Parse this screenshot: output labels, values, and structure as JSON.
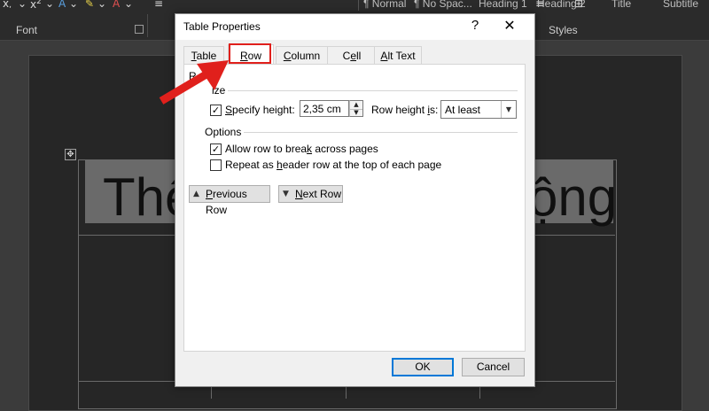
{
  "ribbon": {
    "font_group": "Font",
    "styles_group": "Styles",
    "format_glyphs": [
      "x,",
      "x²"
    ],
    "styles": [
      "¶ Normal",
      "¶ No Spac...",
      "Heading 1",
      "Heading 2",
      "Title",
      "Subtitle"
    ]
  },
  "document": {
    "text_left": "Thê",
    "text_right": "ộng"
  },
  "dialog": {
    "title": "Table Properties",
    "help": "?",
    "close": "✕",
    "tabs": [
      "Table",
      "Row",
      "Column",
      "Cell",
      "Alt Text"
    ],
    "active_tab": "Row",
    "row_label": "R",
    "size_section": "Size",
    "specify_height_label": "Specify height:",
    "specify_height_checked": true,
    "height_value": "2,35 cm",
    "row_height_is_label": "Row height is:",
    "row_height_is_value": "At least",
    "options_section": "Options",
    "allow_break_label": "Allow row to break across pages",
    "allow_break_checked": true,
    "repeat_header_label": "Repeat as header row at the top of each page",
    "repeat_header_checked": false,
    "previous_row": "Previous Row",
    "next_row": "Next Row",
    "ok": "OK",
    "cancel": "Cancel"
  },
  "colors": {
    "highlight": "#e0201c",
    "dialog_bg": "#f0f0f0",
    "ribbon_bg": "#2b2b2b"
  }
}
